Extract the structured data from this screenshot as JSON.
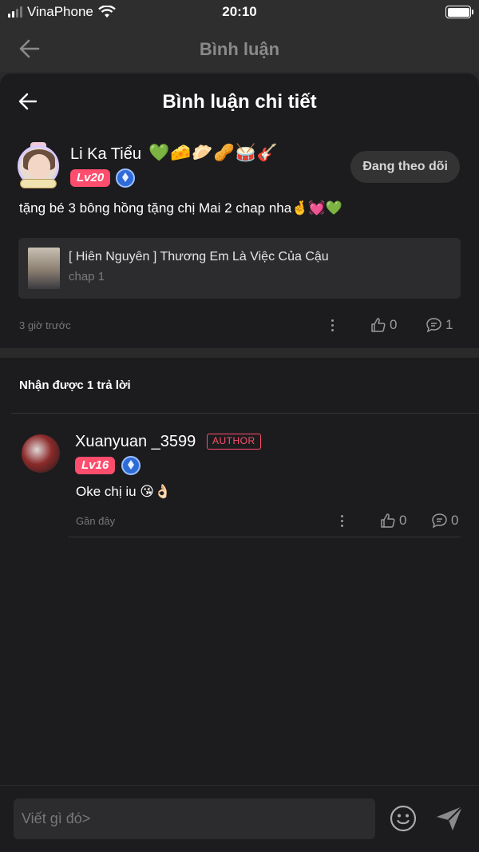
{
  "status_bar": {
    "carrier": "VinaPhone",
    "time": "20:10",
    "battery_level": 1.0
  },
  "background_header": {
    "title": "Bình luận"
  },
  "sheet": {
    "title": "Bình luận chi tiết"
  },
  "comment": {
    "user_name": "Li Ka Tiểu",
    "name_emojis": "💚🧀🥟🥜🥁🎸",
    "level": "Lv20",
    "follow_label": "Đang theo dõi",
    "text": "tặng bé 3 bông hồng tặng chị Mai 2 chap nha🤞💓💚",
    "linked": {
      "title": "[ Hiên Nguyên ] Thương Em Là Việc Của Cậu",
      "subtitle": "chap 1"
    },
    "time": "3 giờ trước",
    "likes": "0",
    "replies": "1"
  },
  "replies_heading": "Nhận được 1 trả lời",
  "reply": {
    "user_name": "Xuanyuan _3599",
    "author_tag": "AUTHOR",
    "level": "Lv16",
    "text": "Oke chị iu 😘👌🏻",
    "time": "Gần đây",
    "likes": "0",
    "replies": "0"
  },
  "composer": {
    "placeholder": "Viết gì đó>"
  },
  "colors": {
    "accent": "#ff4d6d",
    "background": "#1c1c1e",
    "card": "#2c2c2e"
  },
  "icons": [
    "back-arrow-icon",
    "thumbs-up-icon",
    "comment-bubble-icon",
    "more-dots-icon",
    "smiley-icon",
    "send-icon",
    "wifi-icon",
    "signal-icon",
    "battery-icon",
    "tier-diamond-icon"
  ]
}
